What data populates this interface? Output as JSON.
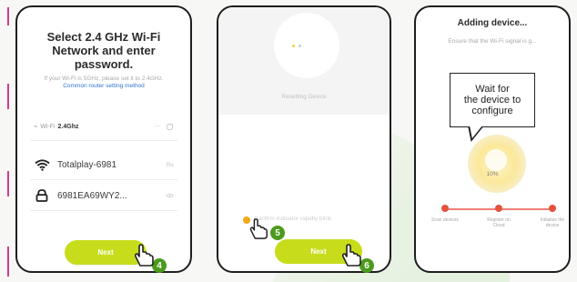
{
  "screen1": {
    "title_line1": "Select 2.4 GHz Wi-Fi",
    "title_line2": "Network and enter",
    "title_line3": "password.",
    "note_part1": "If your Wi-Fi is 5GHz, please set it",
    "note_part2": "to 2.4GHz.",
    "note_link": "Common router setting method",
    "wifi_label": "Wi-Fi",
    "wifi_band": "2.4Ghz",
    "network_name": "Totalplay-6981",
    "password_value": "6981EA69WY2...",
    "network_trailing": "Re",
    "next_label": "Next"
  },
  "screen2": {
    "caption": "Resetting Device",
    "confirm_text": "Confirm indicator rapidly blink",
    "next_label": "Next"
  },
  "screen3": {
    "title": "Adding device...",
    "subtitle": "Ensure that the Wi-Fi signal is g...",
    "percent": "10%",
    "steps": [
      {
        "label": "Scan devices"
      },
      {
        "label": "Register on Cloud"
      },
      {
        "label": "Initialize the device"
      }
    ]
  },
  "callout": {
    "line1": "Wait for",
    "line2": "the device to",
    "line3": "configure"
  },
  "badges": {
    "b4": "4",
    "b5": "5",
    "b6": "6"
  },
  "icons": {
    "wifi": "wifi-icon",
    "lock": "lock-icon",
    "refresh": "refresh-icon",
    "hand": "hand-cursor-icon"
  },
  "colors": {
    "button": "#c7dd1c",
    "badge": "#4c9a1d",
    "progress": "#e5533c",
    "link": "#2f76d2"
  }
}
